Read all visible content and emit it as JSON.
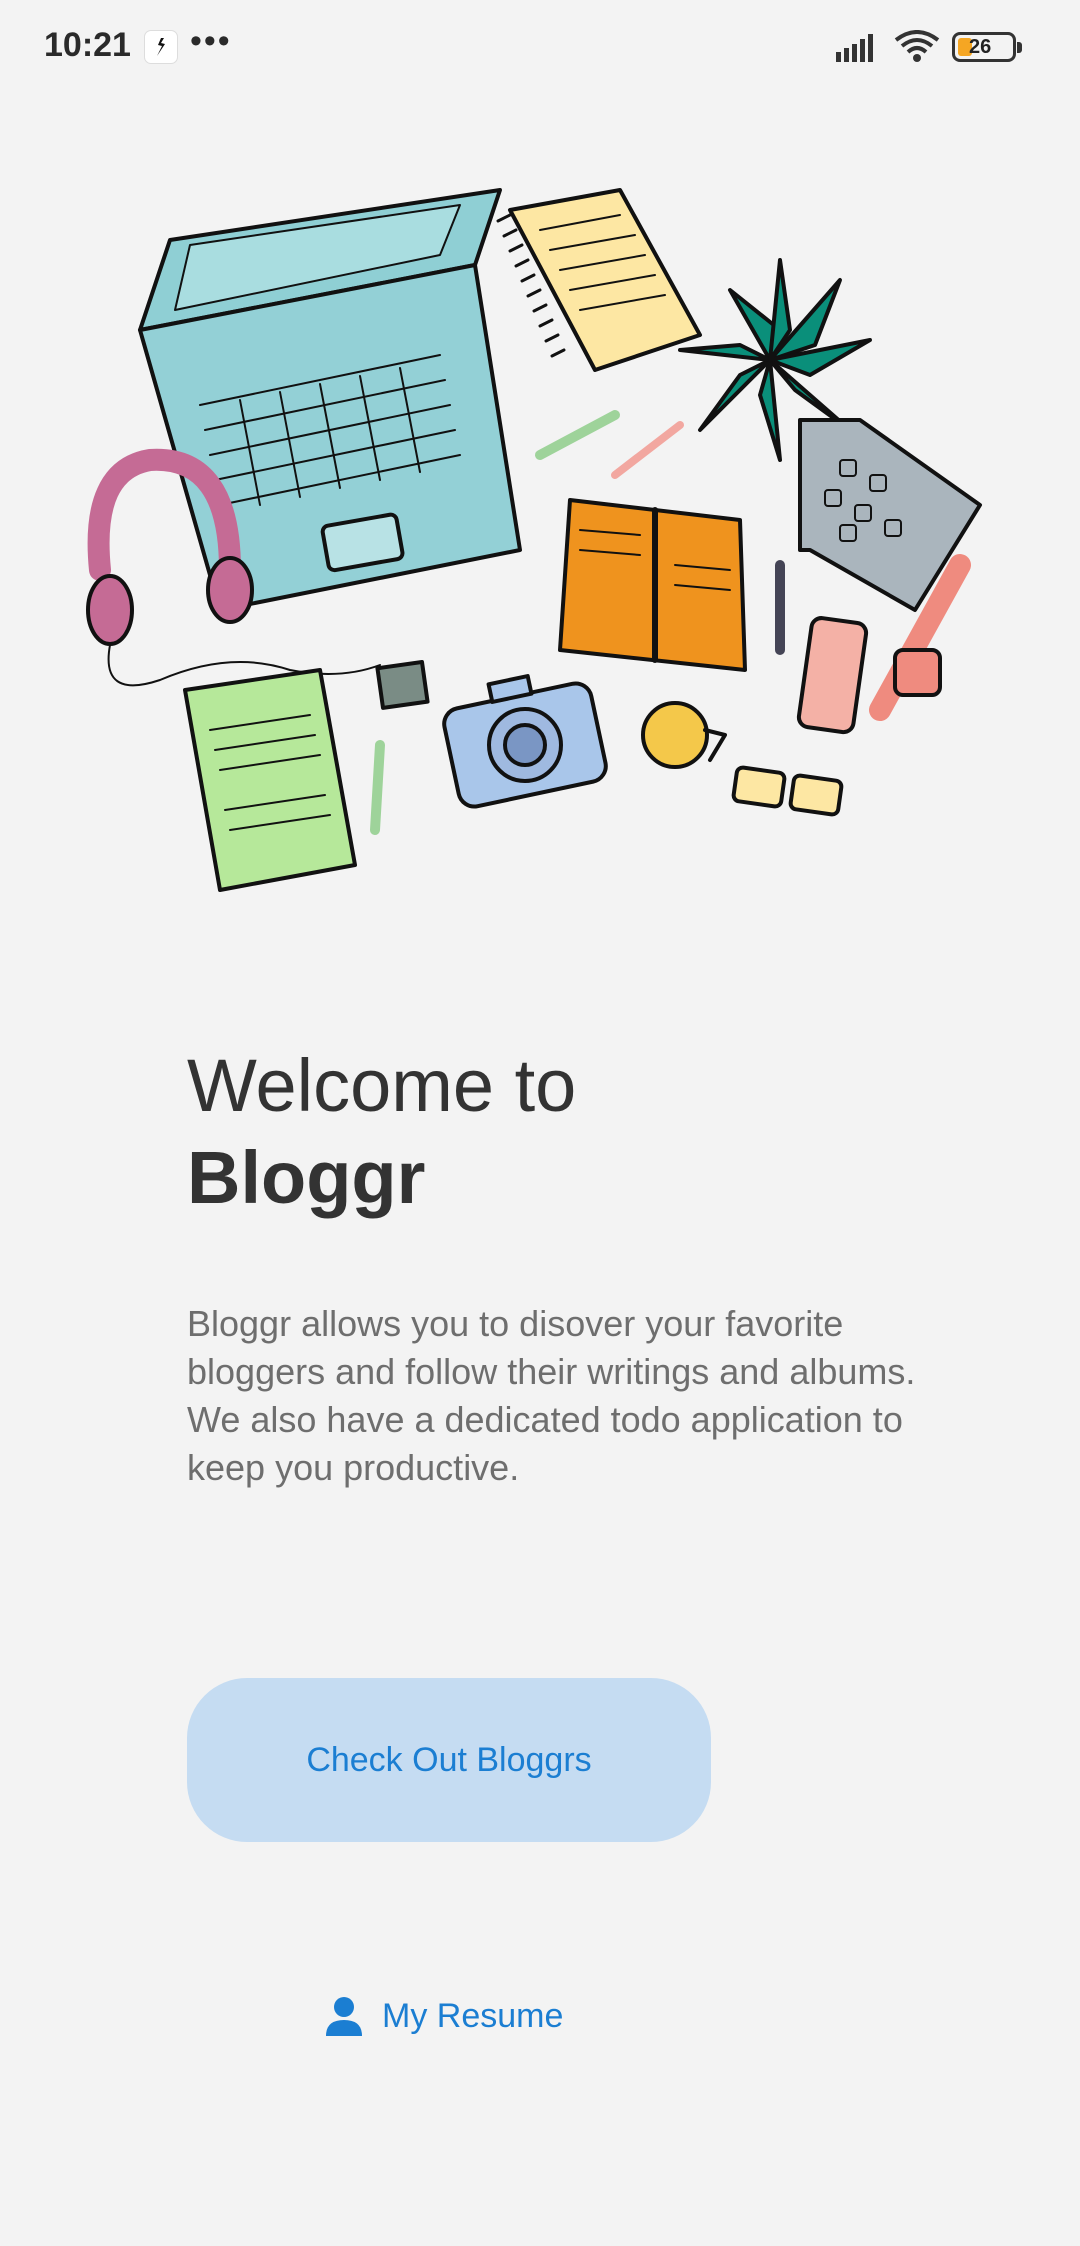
{
  "status_bar": {
    "time": "10:21",
    "overflow": "•••",
    "battery_level": "26",
    "icons": [
      "app-notification-icon",
      "signal-icon",
      "wifi-icon",
      "battery-icon"
    ]
  },
  "hero": {
    "illustration": "desk-workspace-illustration"
  },
  "welcome": {
    "line1": "Welcome to",
    "app_name": "Bloggr"
  },
  "description": "Bloggr allows you to disover your favorite bloggers and follow their writings and albums. We also have a dedicated todo application to keep you productive.",
  "actions": {
    "primary_label": "Check Out Bloggrs",
    "secondary_label": "My Resume",
    "secondary_icon": "person-icon"
  },
  "colors": {
    "background": "#f3f3f3",
    "accent": "#1b7ed2",
    "button_bg": "#c5dcf2",
    "title": "#333333",
    "body_text": "#6e6e6e"
  }
}
